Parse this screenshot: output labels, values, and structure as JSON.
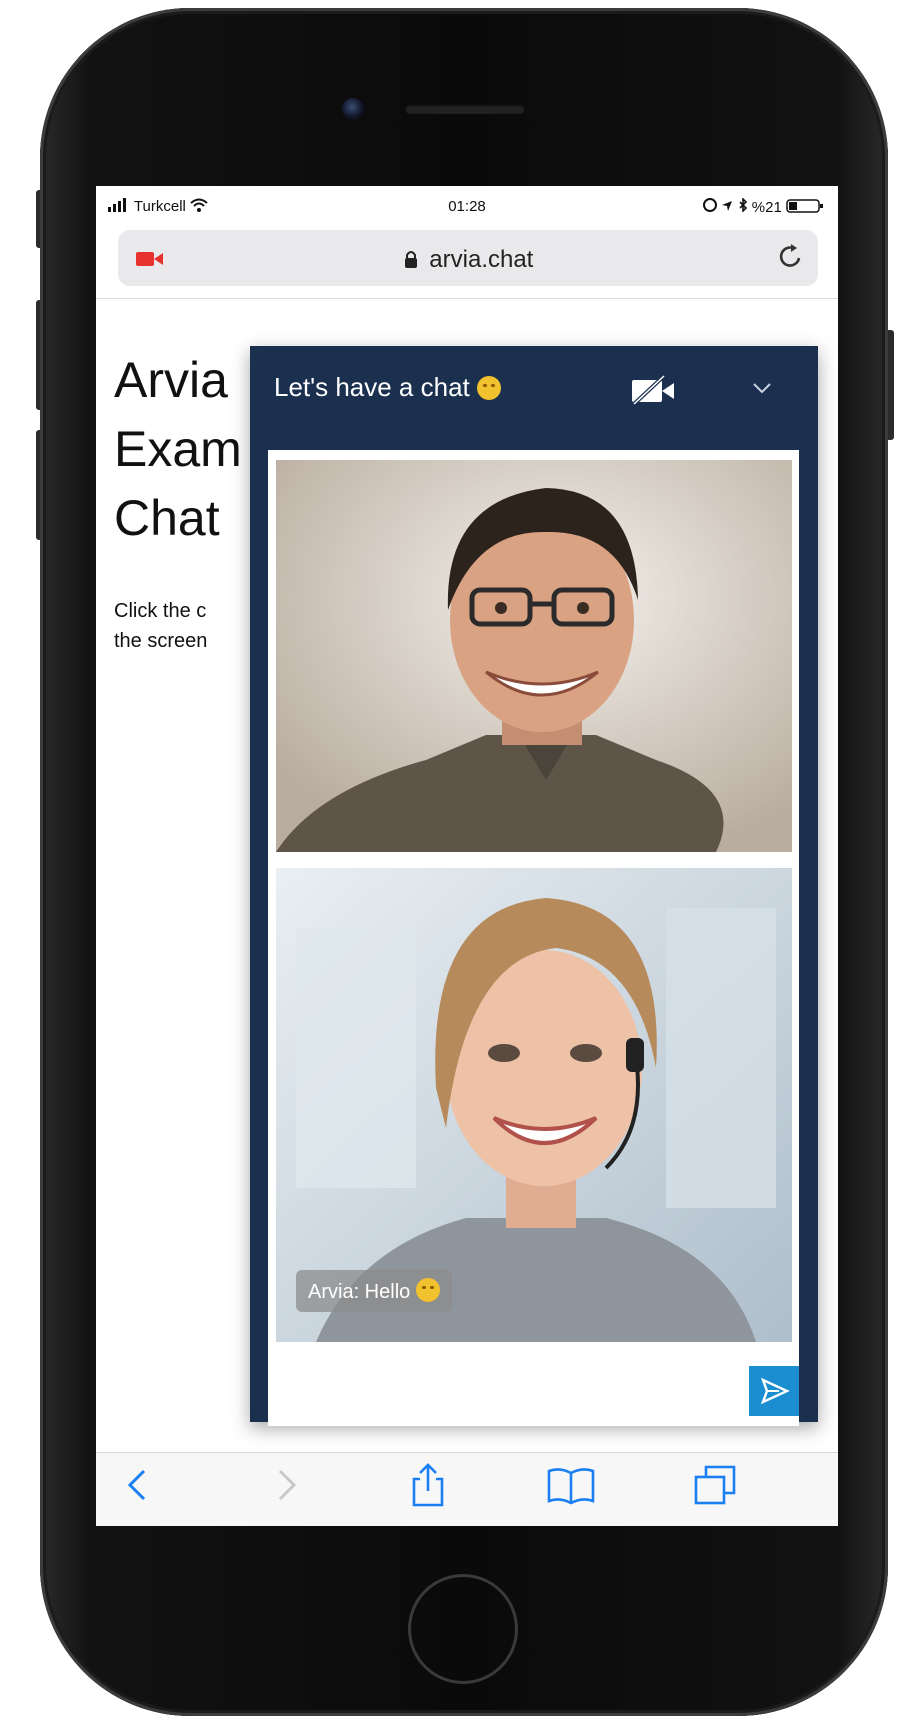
{
  "status": {
    "carrier": "Turkcell",
    "time": "01:28",
    "battery": "%21"
  },
  "browser": {
    "url": "arvia.chat"
  },
  "page": {
    "title_lines": [
      "Arvia",
      "Exam",
      "Chat"
    ],
    "body_lines": [
      "Click the c",
      "the screen"
    ]
  },
  "chat": {
    "title": "Let's have a chat",
    "message": "Arvia: Hello"
  },
  "colors": {
    "chat_header": "#1b2f4f",
    "send_button": "#1a8ed1",
    "record_icon": "#e5322d",
    "toolbar_icons": "#1a7ff0"
  },
  "icons": {
    "record": "record-video-icon",
    "lock": "lock-icon",
    "reload": "reload-icon",
    "camera_off": "camera-off-icon",
    "chevron": "chevron-down-icon",
    "send": "send-icon"
  }
}
